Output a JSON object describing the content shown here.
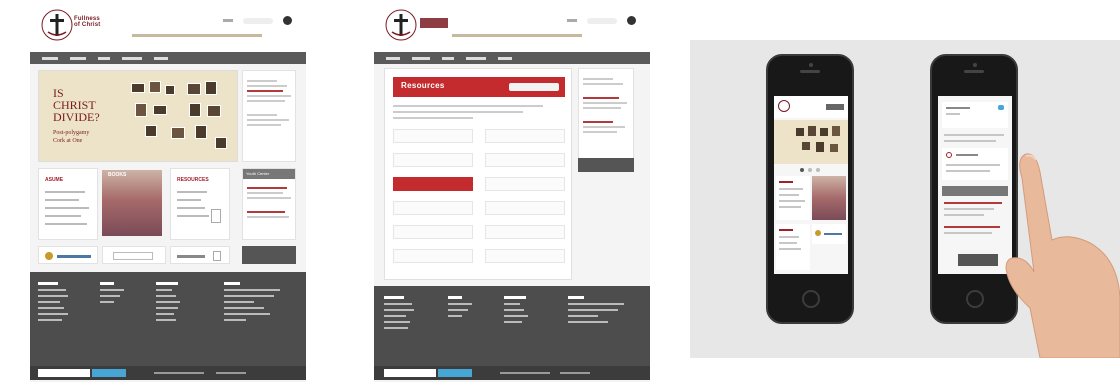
{
  "site_home": {
    "logo_text_line1": "Fullness",
    "logo_text_line2": "of Christ",
    "hero_title": "IS CHRIST DIVIDE?",
    "hero_sub1": "Post-polygamy",
    "hero_sub2": "Cork at One",
    "card1_title": "ASUME",
    "card2_title": "BOOKS",
    "card3_title": "RESOURCES",
    "side_label": "Youth Center"
  },
  "site_resources": {
    "panel_title": "Resources"
  },
  "colors": {
    "brand_red": "#c42b2f",
    "nav_gray": "#5a5a5a",
    "footer_gray": "#4d4d4d",
    "accent_blue": "#46a6d6"
  }
}
